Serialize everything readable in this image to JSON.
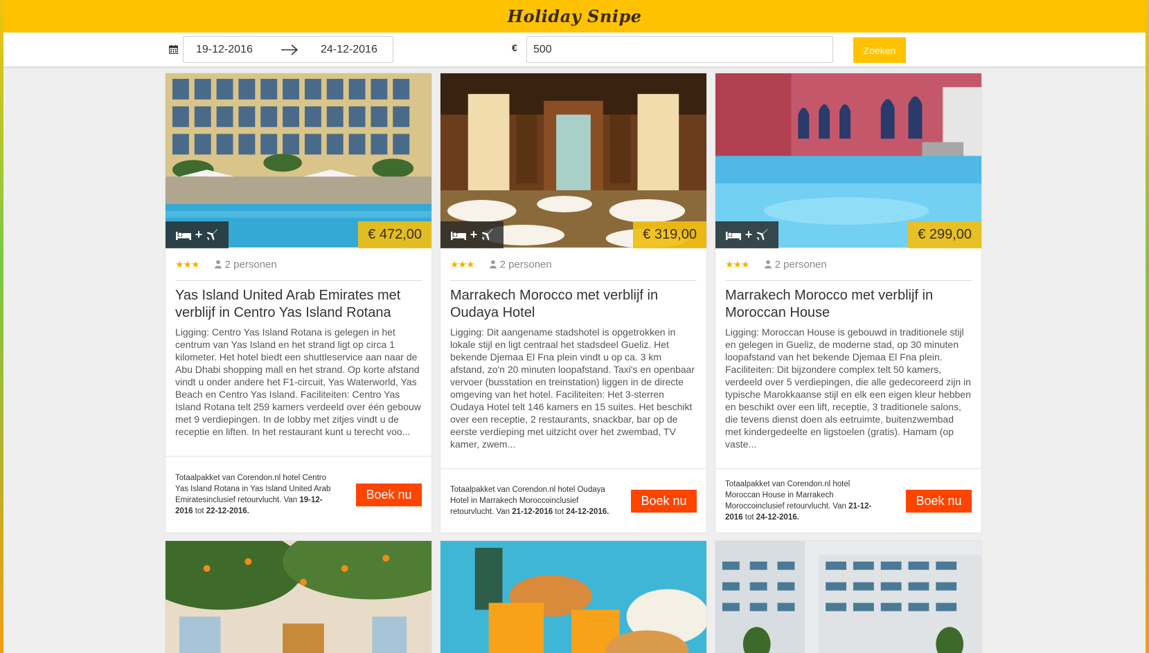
{
  "header": {
    "logo": "Holiday Snipe"
  },
  "search": {
    "date_from": "19-12-2016",
    "date_to": "24-12-2016",
    "currency": "€",
    "budget": "500",
    "search_label": "Zoeken"
  },
  "cards": [
    {
      "type_label": "+",
      "price": "€ 472,00",
      "stars": "★★★",
      "persons": "2 personen",
      "title": "Yas Island United Arab Emirates met verblijf in Centro Yas Island Rotana",
      "description": "Ligging: Centro Yas Island Rotana is gelegen in het centrum van Yas Island en het strand ligt op circa 1 kilometer. Het hotel biedt een shuttleservice aan naar de Abu Dhabi shopping mall en het strand. Op korte afstand vindt u onder andere het F1-circuit, Yas Waterworld, Yas Beach en Centro Yas Island. Faciliteiten: Centro Yas Island Rotana telt 259 kamers verdeeld over één gebouw met 9 verdiepingen. In de lobby met zitjes vindt u de receptie en liften. In het restaurant kunt u terecht voo...",
      "package_text": "Totaalpakket van Corendon.nl hotel Centro Yas Island Rotana in Yas Island United Arab Emiratesinclusief retourvlucht. Van ",
      "package_from": "19-12-2016",
      "package_mid": " tot ",
      "package_to": "22-12-2016.",
      "book_label": "Boek nu"
    },
    {
      "type_label": "+",
      "price": "€ 319,00",
      "stars": "★★★",
      "persons": "2 personen",
      "title": "Marrakech Morocco met verblijf in Oudaya Hotel",
      "description": "Ligging: Dit aangename stadshotel is opgetrokken in lokale stijl en ligt centraal het stadsdeel Gueliz. Het bekende Djemaa El Fna plein vindt u op ca. 3 km afstand, zo'n 20 minuten loopafstand. Taxi's en openbaar vervoer (busstation en treinstation) liggen in de directe omgeving van het hotel. Faciliteiten: Het 3-sterren Oudaya Hotel telt 146 kamers en 15 suites. Het beschikt over een receptie, 2 restaurants, snackbar, bar op de eerste verdieping met uitzicht over het zwembad, TV kamer, zwem...",
      "package_text": "Totaalpakket van Corendon.nl hotel Oudaya Hotel in Marrakech Moroccoinclusief retourvlucht. Van ",
      "package_from": "21-12-2016",
      "package_mid": " tot ",
      "package_to": "24-12-2016.",
      "book_label": "Boek nu"
    },
    {
      "type_label": "+",
      "price": "€ 299,00",
      "stars": "★★★",
      "persons": "2 personen",
      "title": "Marrakech Morocco met verblijf in Moroccan House",
      "description": "Ligging: Moroccan House is gebouwd in traditionele stijl en gelegen in Gueliz, de moderne stad, op 30 minuten loopafstand van het bekende Djemaa El Fna plein. Faciliteiten: Dit bijzondere complex telt 50 kamers, verdeeld over 5 verdiepingen, die alle gedecoreerd zijn in typische Marokkaanse stijl en elk een eigen kleur hebben en beschikt over een lift, receptie, 3 traditionele salons, die tevens dienst doen als eetruimte, buitenzwembad met kindergedeelte en ligstoelen (gratis). Hamam (op vaste...",
      "package_text": "Totaalpakket van Corendon.nl hotel Moroccan House in Marrakech Moroccoinclusief retourvlucht. Van ",
      "package_from": "21-12-2016",
      "package_mid": " tot ",
      "package_to": "24-12-2016.",
      "book_label": "Boek nu"
    }
  ],
  "colors": {
    "brand_yellow": "#ffc200",
    "book_button": "#ff4400",
    "star": "#f0b400"
  }
}
